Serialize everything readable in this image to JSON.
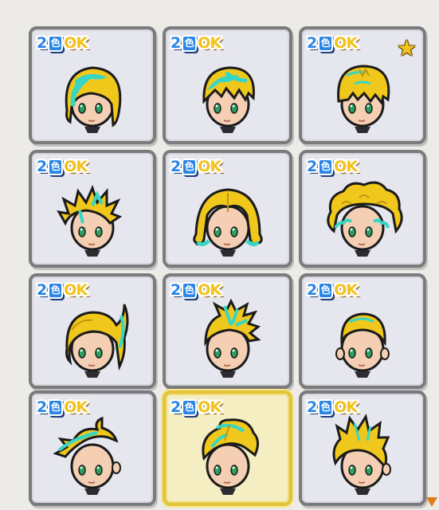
{
  "badge": {
    "num": "2",
    "char": "色",
    "ok": "OK"
  },
  "colors": {
    "hair": "#f0c81c",
    "hair_shade": "#c39310",
    "highlight": "#36d6c4",
    "skin": "#f4cfb4",
    "eye": "#2aa05e",
    "outline": "#1b1b1b",
    "selected_border": "#e2c339",
    "star": "#f2c21d"
  },
  "grid": {
    "rows": [
      [
        {
          "style": "bob-teal",
          "star": false,
          "selected": false
        },
        {
          "style": "tousled-teal",
          "star": false,
          "selected": false
        },
        {
          "style": "short-messy",
          "star": true,
          "selected": false
        }
      ],
      [
        {
          "style": "spiky",
          "star": false,
          "selected": false
        },
        {
          "style": "curled-bob",
          "star": false,
          "selected": false
        },
        {
          "style": "afro",
          "star": false,
          "selected": false
        }
      ],
      [
        {
          "style": "ponytail",
          "star": false,
          "selected": false
        },
        {
          "style": "mohawk",
          "star": false,
          "selected": false
        },
        {
          "style": "buzz",
          "star": false,
          "selected": false
        }
      ],
      [
        {
          "style": "swoop",
          "star": false,
          "selected": false
        },
        {
          "style": "quiff",
          "star": false,
          "selected": true
        },
        {
          "style": "flame",
          "star": false,
          "selected": false
        }
      ]
    ]
  },
  "icons": {
    "favorite": "star-icon",
    "scroll": "scroll-down-arrow-icon"
  }
}
